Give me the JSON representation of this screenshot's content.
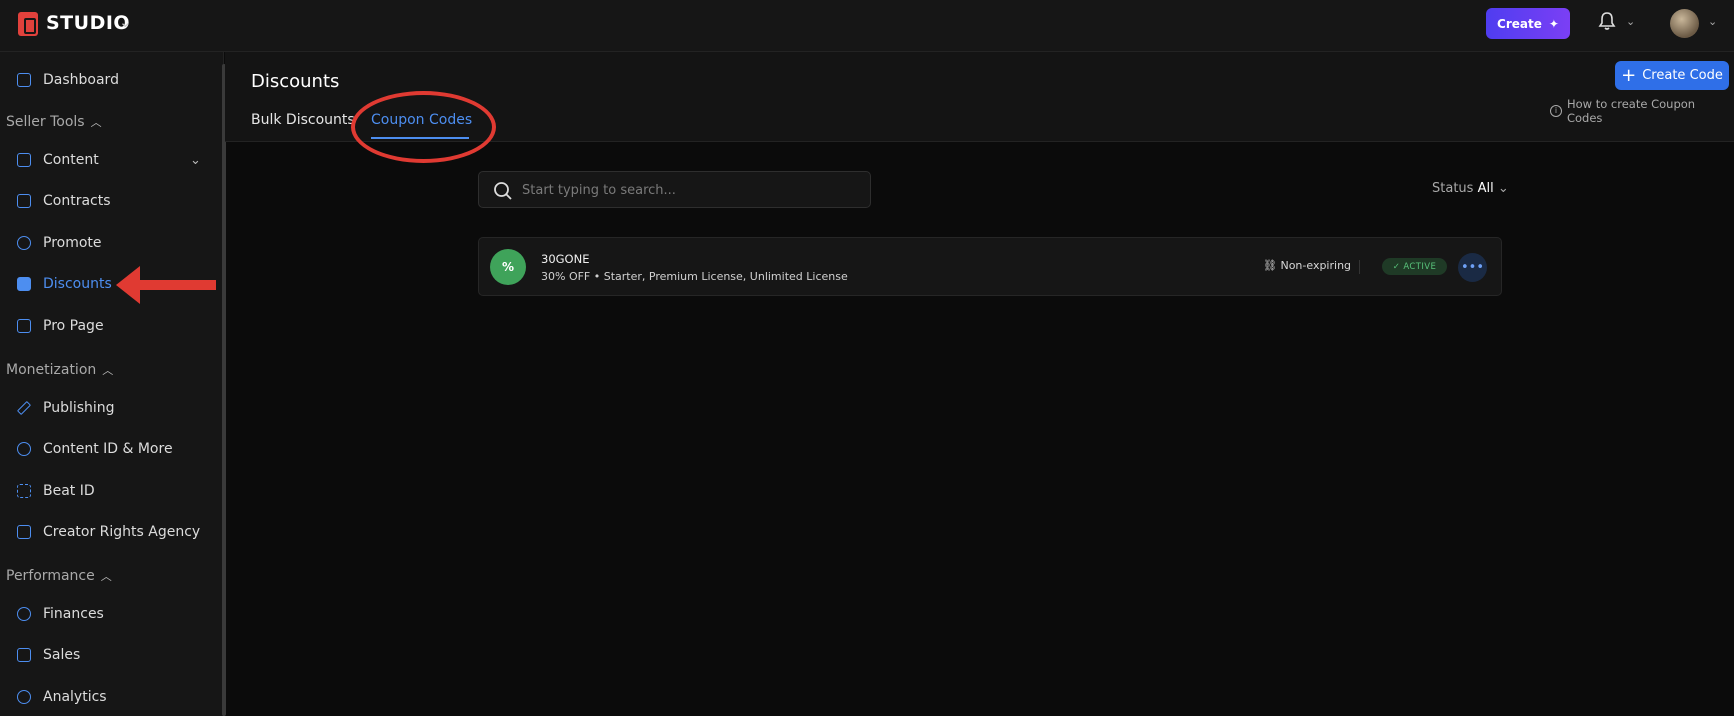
{
  "topbar": {
    "brand": "STUDIO",
    "create_label": "Create"
  },
  "sidebar": {
    "dashboard": "Dashboard",
    "section_seller_tools": "Seller Tools",
    "content": "Content",
    "contracts": "Contracts",
    "promote": "Promote",
    "discounts": "Discounts",
    "pro_page": "Pro Page",
    "section_monetization": "Monetization",
    "publishing": "Publishing",
    "content_id": "Content ID & More",
    "beat_id": "Beat ID",
    "creator_rights": "Creator Rights Agency",
    "section_performance": "Performance",
    "finances": "Finances",
    "sales": "Sales",
    "analytics": "Analytics"
  },
  "main": {
    "title": "Discounts",
    "tabs": [
      "Bulk Discounts",
      "Coupon Codes"
    ],
    "active_tab": "Coupon Codes",
    "create_code_label": "Create Code",
    "howto_label": "How to create Coupon Codes",
    "search_placeholder": "Start typing to search...",
    "status_label": "Status",
    "status_value": "All"
  },
  "coupons": [
    {
      "code": "30GONE",
      "description": "30% OFF • Starter, Premium License, Unlimited License",
      "expiry": "Non-expiring",
      "status": "ACTIVE"
    }
  ],
  "colors": {
    "accent": "#4d8ef0",
    "annotation_red": "#e03a32",
    "active_green": "#58c27a"
  }
}
